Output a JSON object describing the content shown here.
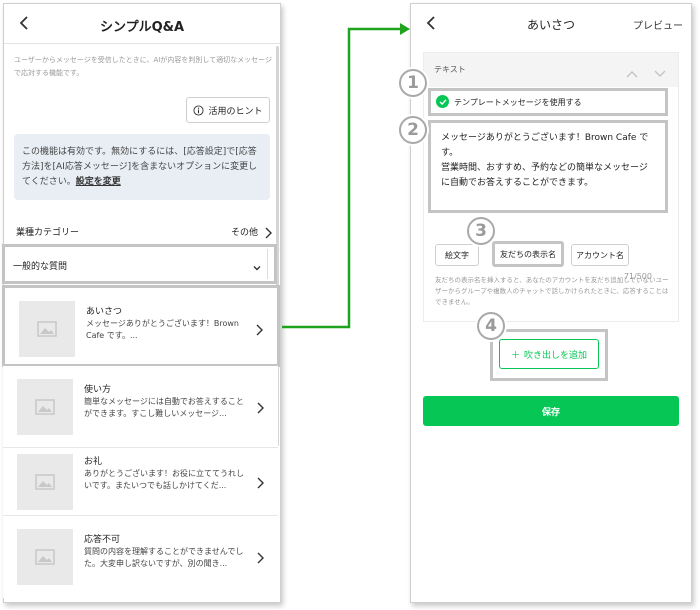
{
  "left_screen": {
    "header": {
      "title": "シンプルQ&A"
    },
    "description": "ユーザーからメッセージを受信したときに、AIが内容を判別して適切なメッセージで応対する機能です。",
    "tip_button": {
      "label": "活用のヒント"
    },
    "notice": {
      "text": "この機能は有効です。無効にするには、[応答設定]で[応答方法]を[AI応答メッセージ]を含まないオプションに変更してください。",
      "link": "設定を変更"
    },
    "industry": {
      "label": "業種カテゴリー",
      "value": "その他"
    },
    "category": {
      "label": "一般的な質問"
    },
    "qa_items": [
      {
        "title": "あいさつ",
        "body": "メッセージありがとうございます！Brown Cafe です。..."
      },
      {
        "title": "使い方",
        "body": "簡単なメッセージには自動でお答えすることができます。すこし難しいメッセージ..."
      },
      {
        "title": "お礼",
        "body": "ありがとうございます！お役に立ててうれしいです。またいつでも話しかけてくだ..."
      },
      {
        "title": "応答不可",
        "body": "質問の内容を理解することができませんでした。大変申し訳ないですが、別の聞き..."
      }
    ]
  },
  "right_screen": {
    "header": {
      "title": "あいさつ",
      "preview": "プレビュー"
    },
    "section_label": "テキスト",
    "template_label": "テンプレートメッセージを使用する",
    "message": "メッセージありがとうございます！Brown Cafe です。\n営業時間、おすすめ、予約などの簡単なメッセージに自動でお答えすることができます。",
    "counter": "71/500",
    "insert_buttons": {
      "emoji": "絵文字",
      "friend_name": "友だちの表示名",
      "account_name": "アカウント名"
    },
    "hint": "友だちの表示名を挿入すると、あなたのアカウントを友だち追加していないユーザーからグループや複数人のチャットで話しかけられたときに、応答することはできません。",
    "add_bubble": "吹き出しを追加",
    "save": "保存"
  },
  "badges": [
    "1",
    "2",
    "3",
    "4"
  ],
  "colors": {
    "accent_green": "#06c755",
    "highlight_gray": "#c4c4c4",
    "notice_bg": "#e9eef5"
  }
}
